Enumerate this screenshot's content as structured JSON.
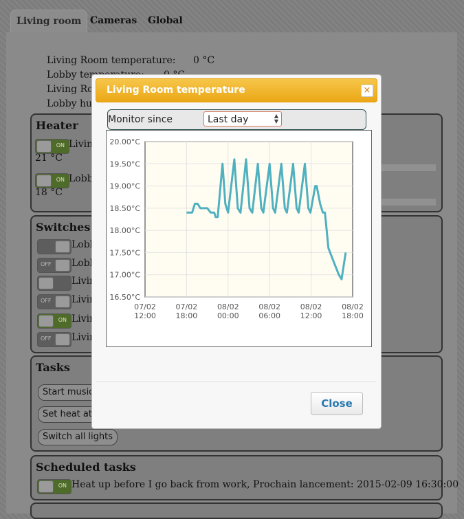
{
  "tabs": [
    "Living room",
    "Cameras",
    "Global"
  ],
  "info": [
    {
      "label": "Living Room temperature:",
      "value": "0 °C"
    },
    {
      "label": "Lobby temperature:",
      "value": "0 °C"
    },
    {
      "label": "Living Ro",
      "value": ""
    },
    {
      "label": "Lobby hun",
      "value": ""
    }
  ],
  "heater": {
    "title": "Heater",
    "items": [
      {
        "state": "ON",
        "label": "Livin",
        "value": "21 °C"
      },
      {
        "state": "ON",
        "label": "Lobb",
        "value": "18 °C"
      }
    ]
  },
  "switches": {
    "title": "Switches",
    "items": [
      {
        "state": "",
        "label": "Lobb"
      },
      {
        "state": "OFF",
        "label": "Lobb"
      },
      {
        "state": "",
        "label": "Livin"
      },
      {
        "state": "OFF",
        "label": "Livin"
      },
      {
        "state": "ON",
        "label": "Livin"
      },
      {
        "state": "OFF",
        "label": "Livin"
      }
    ]
  },
  "tasks": {
    "title": "Tasks",
    "buttons": [
      "Start music",
      "Set heat at 2",
      "Switch all lights"
    ]
  },
  "scheduled": {
    "title": "Scheduled tasks",
    "state": "ON",
    "text": "Heat up before I go back from work, Prochain lancement: 2015-02-09 16:30:00"
  },
  "modal": {
    "title": "Living Room temperature",
    "close_x": "×",
    "monitor_label": "Monitor since",
    "select_value": "Last day",
    "close_button": "Close"
  },
  "colors": {
    "line": "#4fb0c0",
    "plot_bg": "#fffdf2",
    "header": "#f0b429"
  },
  "chart_data": {
    "type": "line",
    "ylim": [
      16.5,
      20.0
    ],
    "y_ticks": [
      "20.00°C",
      "19.50°C",
      "19.00°C",
      "18.50°C",
      "18.00°C",
      "17.50°C",
      "17.00°C",
      "16.50°C"
    ],
    "x_ticks": [
      {
        "l1": "07/02",
        "l2": "12:00"
      },
      {
        "l1": "07/02",
        "l2": "18:00"
      },
      {
        "l1": "08/02",
        "l2": "00:00"
      },
      {
        "l1": "08/02",
        "l2": "06:00"
      },
      {
        "l1": "08/02",
        "l2": "12:00"
      },
      {
        "l1": "08/02",
        "l2": "18:00"
      }
    ],
    "x_range_hours": [
      0,
      30
    ],
    "grid": true,
    "series": [
      {
        "points": [
          [
            6.0,
            18.4
          ],
          [
            6.8,
            18.4
          ],
          [
            7.2,
            18.6
          ],
          [
            7.6,
            18.6
          ],
          [
            8.0,
            18.5
          ],
          [
            9.0,
            18.5
          ],
          [
            9.5,
            18.4
          ],
          [
            10.0,
            18.4
          ],
          [
            10.2,
            18.3
          ],
          [
            10.5,
            18.3
          ],
          [
            11.2,
            19.5
          ],
          [
            11.6,
            18.6
          ],
          [
            12.0,
            18.4
          ],
          [
            12.9,
            19.6
          ],
          [
            13.4,
            18.5
          ],
          [
            13.8,
            18.4
          ],
          [
            14.6,
            19.6
          ],
          [
            15.1,
            18.5
          ],
          [
            15.5,
            18.4
          ],
          [
            16.3,
            19.5
          ],
          [
            16.8,
            18.5
          ],
          [
            17.1,
            18.4
          ],
          [
            18.0,
            19.5
          ],
          [
            18.5,
            18.5
          ],
          [
            18.8,
            18.4
          ],
          [
            19.7,
            19.5
          ],
          [
            20.2,
            18.5
          ],
          [
            20.5,
            18.4
          ],
          [
            21.4,
            19.5
          ],
          [
            21.9,
            18.5
          ],
          [
            22.2,
            18.4
          ],
          [
            23.1,
            19.5
          ],
          [
            23.6,
            18.5
          ],
          [
            23.9,
            18.4
          ],
          [
            24.6,
            19.0
          ],
          [
            24.8,
            19.0
          ],
          [
            25.3,
            18.6
          ],
          [
            25.7,
            18.4
          ],
          [
            26.0,
            18.4
          ],
          [
            26.5,
            17.6
          ],
          [
            27.0,
            17.4
          ],
          [
            27.5,
            17.2
          ],
          [
            28.0,
            17.0
          ],
          [
            28.4,
            16.9
          ],
          [
            28.7,
            17.2
          ],
          [
            29.0,
            17.5
          ]
        ]
      }
    ]
  }
}
